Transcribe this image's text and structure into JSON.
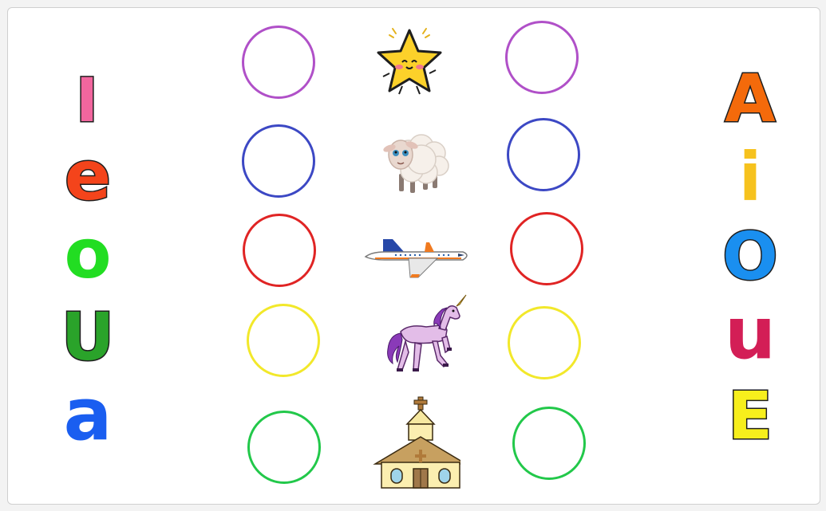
{
  "left_letters": [
    {
      "char": "I",
      "color": "#f2669e"
    },
    {
      "char": "e",
      "color": "#f4441b"
    },
    {
      "char": "o",
      "color": "#22dd22"
    },
    {
      "char": "U",
      "color": "#2aa32a"
    },
    {
      "char": "a",
      "color": "#1a5ef0"
    }
  ],
  "right_letters": [
    {
      "char": "A",
      "color": "#f46a0b"
    },
    {
      "char": "i",
      "color": "#f6c21e"
    },
    {
      "char": "O",
      "color": "#1a8ff0"
    },
    {
      "char": "u",
      "color": "#d31e56"
    },
    {
      "char": "E",
      "color": "#f7ef1c"
    }
  ],
  "rows": [
    {
      "picture": "star-icon",
      "ring_color": "#b050c8"
    },
    {
      "picture": "sheep-icon",
      "ring_color": "#3c48c4"
    },
    {
      "picture": "airplane-icon",
      "ring_color": "#e02424"
    },
    {
      "picture": "unicorn-icon",
      "ring_color": "#f2e82a"
    },
    {
      "picture": "church-icon",
      "ring_color": "#22c84a"
    }
  ]
}
